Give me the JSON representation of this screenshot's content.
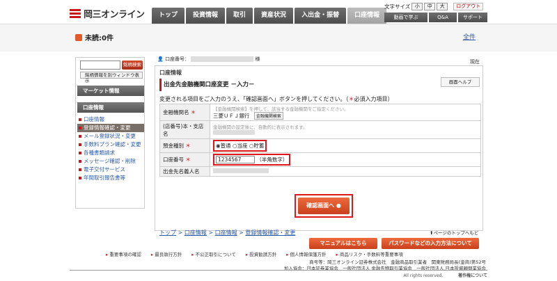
{
  "header": {
    "logo_text": "岡三オンライン",
    "nav": [
      "トップ",
      "投資情報",
      "取引",
      "資産状況",
      "入出金・振替",
      "口座情報"
    ],
    "active_nav": 5,
    "font_size_label": "文字サイズ",
    "font_sizes": [
      "小",
      "中",
      "大"
    ],
    "logout": "ログアウト",
    "util_nav": [
      "動画で学ぶ",
      "Q&A",
      "サポート"
    ]
  },
  "status": {
    "unread": "未読:0件",
    "all_read": "全件"
  },
  "sidebar": {
    "search_button": "銘柄検索",
    "search_separate": "銘柄情報を別ウィンドウ表示",
    "market_info": "マーケット情報",
    "account_info": "口座情報",
    "items": [
      "口座情報",
      "登録情報確認・変更",
      "メール登録状況・変更",
      "手数料プラン確認・変更",
      "各種書類請求",
      "メッセージ確認・削除",
      "電子交付サービス",
      "年間取引報告書等"
    ],
    "current_index": 1
  },
  "main": {
    "account_no_label": "口座番号：",
    "account_suffix": "様",
    "now_label": "現在",
    "subtitle": "口座情報",
    "page_title": "出金先金融機関口座変更 －入力－",
    "help_button": "画面ヘルプ",
    "instruction": "変更される項目をご入力のうえ、「確認画面へ」ボタンを押してください。（",
    "instruction_req": "＊",
    "instruction_end": "必須入力項目）",
    "form": {
      "bank_label": "金融機関名",
      "bank_hint": "【金融機関検索】を押して、該当する金融機関をご指定ください。",
      "bank_value": "三菱ＵＦＪ銀行",
      "bank_search_button": "金融機関検索",
      "branch_label": "(店番号)本・支店名",
      "branch_hint": "金融機関の設定後に、自動的に表示されます。",
      "type_label": "預金種別",
      "type_options": [
        "普通",
        "当座",
        "貯蓄"
      ],
      "type_selected": 0,
      "account_label": "口座番号",
      "account_value": "1234567",
      "account_note": "（半角数字）",
      "holder_label": "出金先名義人名"
    },
    "confirm_button": "確認画面へ",
    "breadcrumb": [
      "トップ",
      "口座情報",
      "口座情報",
      "登録情報確認・変更"
    ],
    "to_top": "ページのトップへもどる"
  },
  "buttons": {
    "manual": "マニュアルはこちら",
    "password": "パスワードなどの入力方法について"
  },
  "footer": {
    "links": [
      "重要事項の確認",
      "最良執行方針",
      "不公正取引について",
      "投資勧誘方針",
      "個人情報保護方針",
      "商品リスク・手数料等重要事項"
    ],
    "line1": "商号等：岡三オンライン証券株式会社　金融商品取引業者　関東財務局長(金商)第52号",
    "line2": "加入協会：日本証券業協会　一般社団法人 金融先物取引業協会　一般社団法人 日本投資顧問業協会",
    "rights": "All rights reserved.",
    "copyright_link": "著作権について"
  },
  "colors": {
    "accent_red": "#c8161d",
    "highlight_red": "#e0161d",
    "orange_button": "#dd5a2c",
    "nav_gray": "#5a5a5a",
    "link_blue": "#2a5aa8"
  }
}
